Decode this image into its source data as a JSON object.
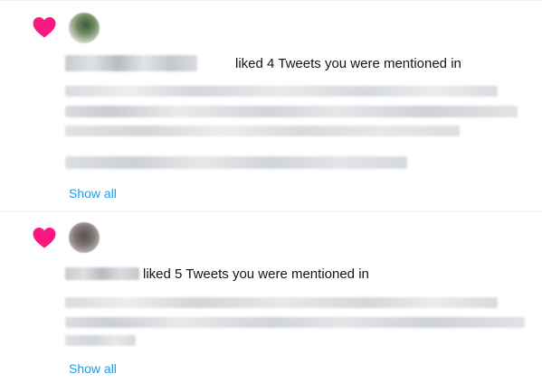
{
  "notifications": [
    {
      "action_text": "liked 4 Tweets you were mentioned in",
      "show_all_label": "Show all"
    },
    {
      "action_text": "liked 5 Tweets you were mentioned in",
      "show_all_label": "Show all"
    }
  ],
  "colors": {
    "heart": "#f91880",
    "link": "#1d9bf0",
    "text": "#0f1419",
    "divider": "#eff3f4",
    "redacted": "#cfd3d6"
  },
  "icons": {
    "like": "heart-icon"
  }
}
